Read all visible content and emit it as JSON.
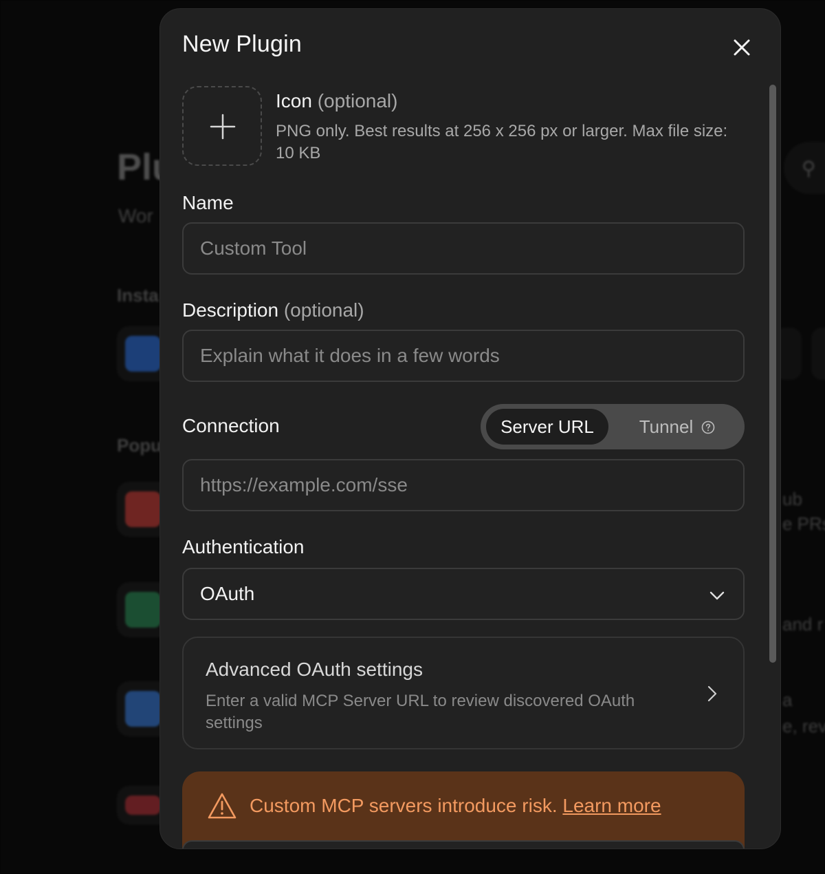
{
  "modal": {
    "title": "New Plugin",
    "icon_field": {
      "label": "Icon",
      "optional": "(optional)",
      "hint": "PNG only. Best results at 256 x 256 px or larger. Max file size: 10 KB"
    },
    "name_field": {
      "label": "Name",
      "placeholder": "Custom Tool"
    },
    "description_field": {
      "label": "Description",
      "optional": "(optional)",
      "placeholder": "Explain what it does in a few words"
    },
    "connection": {
      "label": "Connection",
      "options": [
        "Server URL",
        "Tunnel"
      ],
      "selected": "Server URL",
      "url_placeholder": "https://example.com/sse"
    },
    "authentication": {
      "label": "Authentication",
      "selected": "OAuth"
    },
    "advanced": {
      "title": "Advanced OAuth settings",
      "description": "Enter a valid MCP Server URL to review discovered OAuth settings"
    },
    "warning": {
      "text": "Custom MCP servers introduce risk.",
      "link": "Learn more"
    }
  },
  "colors": {
    "modal_bg": "#212121",
    "warning_bg": "#5a3319",
    "warning_fg": "#f39a60"
  },
  "icons": [
    "close-icon",
    "plus-icon",
    "help-circle-icon",
    "chevron-down-icon",
    "chevron-right-icon",
    "warning-triangle-icon"
  ]
}
